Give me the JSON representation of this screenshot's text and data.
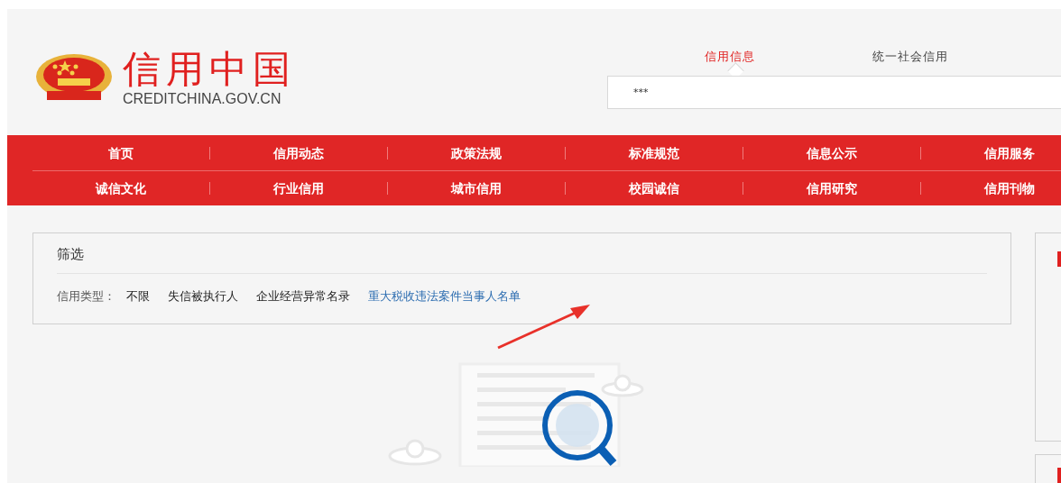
{
  "logo": {
    "title": "信用中国",
    "domain": "CREDITCHINA.GOV.CN"
  },
  "search": {
    "tabs": [
      {
        "label": "信用信息",
        "selected": true
      },
      {
        "label": "统一社会信用",
        "selected": false
      }
    ],
    "value": "***"
  },
  "nav": {
    "rows": [
      [
        "首页",
        "信用动态",
        "政策法规",
        "标准规范",
        "信息公示",
        "信用服务"
      ],
      [
        "诚信文化",
        "行业信用",
        "城市信用",
        "校园诚信",
        "信用研究",
        "信用刊物"
      ]
    ]
  },
  "filter": {
    "title": "筛选",
    "label": "信用类型：",
    "options": [
      {
        "label": "不限",
        "selected": false
      },
      {
        "label": "失信被执行人",
        "selected": false
      },
      {
        "label": "企业经营异常名录",
        "selected": false
      },
      {
        "label": "重大税收违法案件当事人名单",
        "selected": true
      }
    ]
  }
}
